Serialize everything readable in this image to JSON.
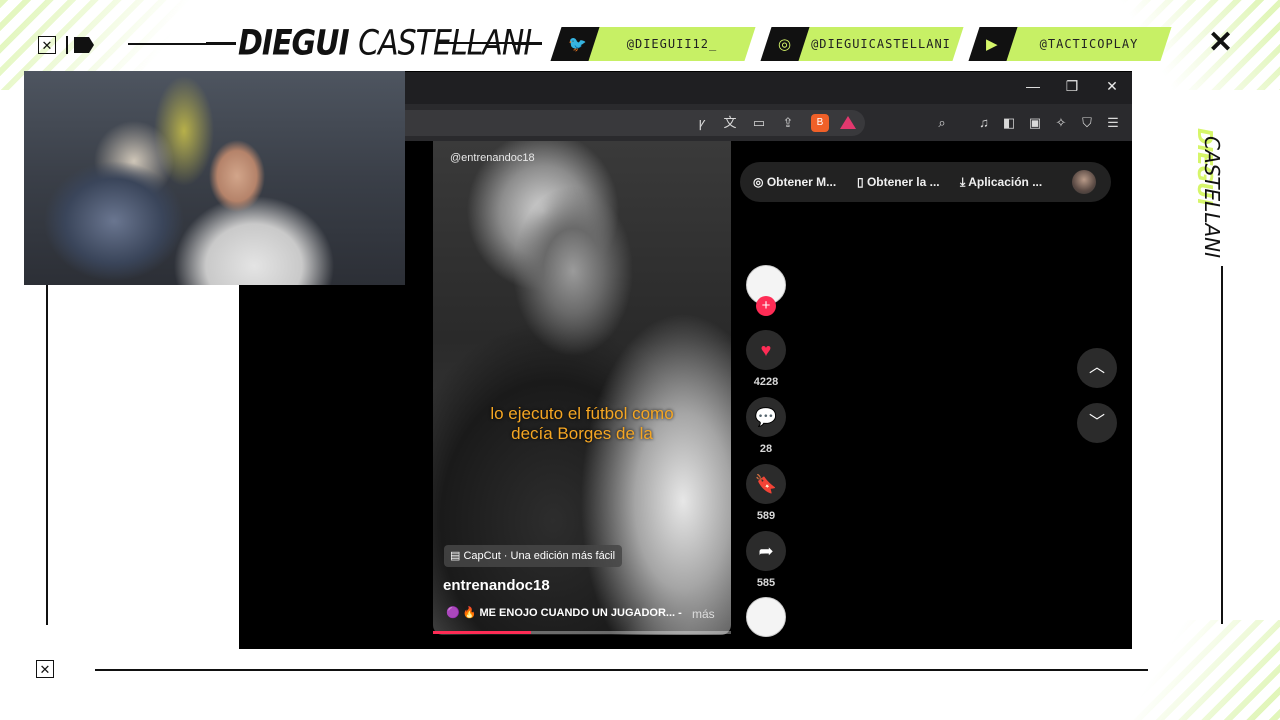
{
  "overlay": {
    "brand_bold": "DIEGUI",
    "brand_light": "CASTELLANI",
    "socials": [
      {
        "icon": "twitter-icon",
        "handle": "@DIEGUII12_"
      },
      {
        "icon": "instagram-icon",
        "handle": "@DIEGUICASTELLANI"
      },
      {
        "icon": "youtube-icon",
        "handle": "@TACTICOPLAY"
      }
    ],
    "vertical_brand_bold": "DIEGUI",
    "vertical_brand_light": "CASTELLANI",
    "colors": {
      "accent": "#C7F065",
      "dark": "#111111"
    }
  },
  "tiktok": {
    "video_handle": "@entrenandoc18",
    "caption_line1": "lo ejecuto el fútbol como",
    "caption_line2": "decía Borges de la",
    "capcut_label": "CapCut · Una edición más fácil",
    "author": "entrenandoc18",
    "description": "🟣 🔥 ME ENOJO CUANDO UN JUGADOR... -",
    "more_label": "más",
    "progress": 0.33,
    "likes": "4228",
    "comments": "28",
    "saves": "589",
    "shares": "585",
    "top_actions": [
      {
        "icon": "coin-icon",
        "label": "Obtener M..."
      },
      {
        "icon": "phone-icon",
        "label": "Obtener la ..."
      },
      {
        "icon": "download-icon",
        "label": "Aplicación ..."
      }
    ],
    "colors": {
      "like": "#FE2C55",
      "caption": "#F5A623"
    }
  }
}
